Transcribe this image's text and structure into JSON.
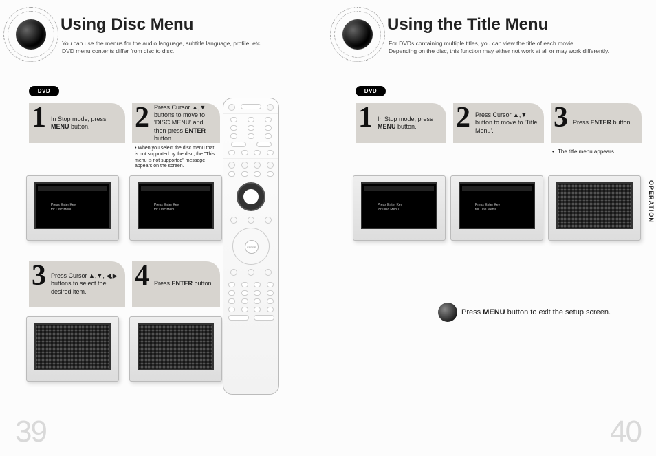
{
  "left": {
    "title": "Using Disc Menu",
    "subtitle": "You can use the menus for the audio language, subtitle language, profile, etc.\nDVD menu contents differ from disc to disc.",
    "badge": "DVD",
    "steps": {
      "s1": {
        "num": "1",
        "text_pre": "In Stop mode, press ",
        "text_bold": "MENU",
        "text_post": " button."
      },
      "s2": {
        "num": "2",
        "text_pre": "Press Cursor ▲,▼ buttons to move to 'DISC MENU' and then press ",
        "text_bold": "ENTER",
        "text_post": " button.",
        "note": "• When you select the disc menu that is not supported by the disc, the \"This menu is not supported\" message appears on the screen."
      },
      "s3": {
        "num": "3",
        "text_pre": "Press Cursor ▲,▼, ◀,▶ buttons to select the desired item.",
        "text_bold": "",
        "text_post": ""
      },
      "s4": {
        "num": "4",
        "text_pre": "Press ",
        "text_bold": "ENTER",
        "text_post": " button."
      }
    },
    "osd1": "Press Enter Key\nfor Disc Menu",
    "osd2": "Press Enter Key\nfor Disc Menu",
    "page_number": "39"
  },
  "right": {
    "title": "Using the Title Menu",
    "subtitle": "For DVDs containing multiple titles, you can view the title of each movie.\nDepending on the disc, this function may either not work at all or may work differently.",
    "badge": "DVD",
    "steps": {
      "s1": {
        "num": "1",
        "text_pre": "In Stop mode, press ",
        "text_bold": "MENU",
        "text_post": " button."
      },
      "s2": {
        "num": "2",
        "text_pre": "Press Cursor ▲,▼ button to move to 'Title Menu'.",
        "text_bold": "",
        "text_post": ""
      },
      "s3": {
        "num": "3",
        "text_pre": "Press ",
        "text_bold": "ENTER",
        "text_post": " button.",
        "bullet": "The title menu appears."
      }
    },
    "osd1": "Press Enter Key\nfor Disc Menu",
    "osd2": "Press Enter Key\nfor Title Menu",
    "exit_pre": "Press ",
    "exit_bold": "MENU",
    "exit_post": " button to exit the setup screen.",
    "side_label": "OPERATION",
    "page_number": "40"
  },
  "remote": {
    "label_enter": "ENTER"
  }
}
